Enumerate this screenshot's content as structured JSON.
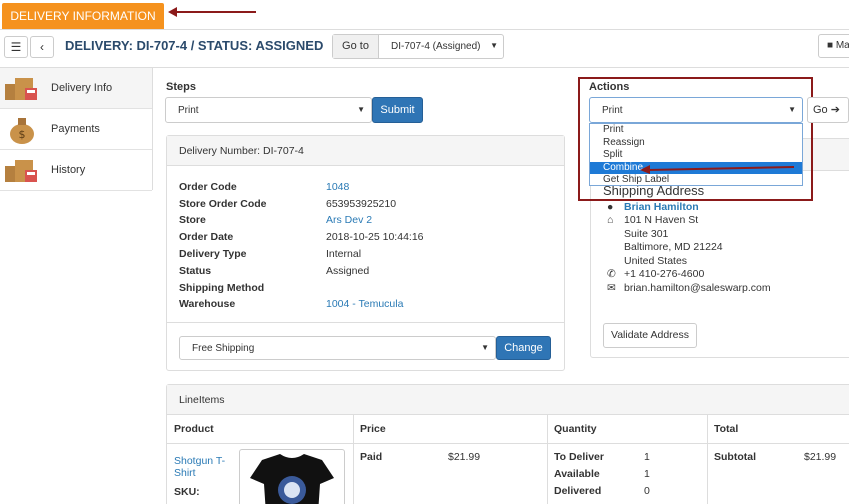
{
  "tabbar": {
    "active_tab": "DELIVERY INFORMATION"
  },
  "header": {
    "title": "DELIVERY: DI-707-4 / STATUS: ASSIGNED",
    "goto_label": "Go to",
    "goto_value": "DI-707-4 (Assigned)",
    "map_label": "Ma"
  },
  "sidebar": {
    "items": [
      {
        "label": "Delivery Info"
      },
      {
        "label": "Payments"
      },
      {
        "label": "History"
      }
    ]
  },
  "steps": {
    "title": "Steps",
    "selected": "Print",
    "submit_label": "Submit"
  },
  "delivery": {
    "number_label": "Delivery Number: DI-707-4",
    "fields": [
      {
        "label": "Order Code",
        "value": "1048",
        "link": true
      },
      {
        "label": "Store Order Code",
        "value": "653953925210",
        "link": false
      },
      {
        "label": "Store",
        "value": "Ars Dev 2",
        "link": true
      },
      {
        "label": "Order Date",
        "value": "2018-10-25 10:44:16",
        "link": false
      },
      {
        "label": "Delivery Type",
        "value": "Internal",
        "link": false
      },
      {
        "label": "Status",
        "value": "Assigned",
        "link": false
      },
      {
        "label": "Shipping Method",
        "value": "",
        "link": false
      },
      {
        "label": "Warehouse",
        "value": "1004 - Temucula",
        "link": true
      }
    ],
    "shipping_select": "Free Shipping",
    "change_label": "Change"
  },
  "actions": {
    "title": "Actions",
    "selected": "Print",
    "go_label": "Go",
    "options": [
      "Print",
      "Reassign",
      "Split",
      "Combine",
      "Get Ship Label"
    ],
    "highlighted": "Combine"
  },
  "shipping_address": {
    "title": "Shipping Address",
    "name": "Brian Hamilton",
    "line1": "101 N Haven St",
    "line2": "Suite 301",
    "line3": "Baltimore, MD 21224",
    "country": "United States",
    "phone": "+1 410-276-4600",
    "email": "brian.hamilton@saleswarp.com",
    "validate_label": "Validate Address"
  },
  "lineitems": {
    "title": "LineItems",
    "columns": [
      "Product",
      "Price",
      "Quantity",
      "Total"
    ],
    "product_name": "Shotgun T-Shirt",
    "sku_label": "SKU:",
    "price_label": "Paid",
    "price_value": "$21.99",
    "qty": [
      {
        "label": "To Deliver",
        "value": "1"
      },
      {
        "label": "Available",
        "value": "1"
      },
      {
        "label": "Delivered",
        "value": "0"
      }
    ],
    "subtotal_label": "Subtotal",
    "subtotal_value": "$21.99"
  },
  "colors": {
    "accent": "#f5921e",
    "primary": "#2f75b5",
    "annotation": "#8b1a1a",
    "highlight": "#1e7ad6"
  }
}
